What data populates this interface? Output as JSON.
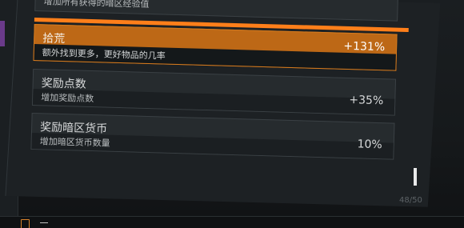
{
  "top_card": {
    "subtitle": "增加所有获得的暗区经验值"
  },
  "perks": [
    {
      "title": "拾荒",
      "subtitle": "额外找到更多，更好物品的几率",
      "value": "+131%"
    },
    {
      "title": "奖励点数",
      "subtitle": "增加奖励点数",
      "value": "+35%"
    },
    {
      "title": "奖励暗区货币",
      "subtitle": "增加暗区货币数量",
      "value": "10%"
    }
  ],
  "counter": "48/50",
  "colors": {
    "accent": "#ff7f1a",
    "selected": "#bd6816",
    "left_strip": "#6a3a8a"
  }
}
